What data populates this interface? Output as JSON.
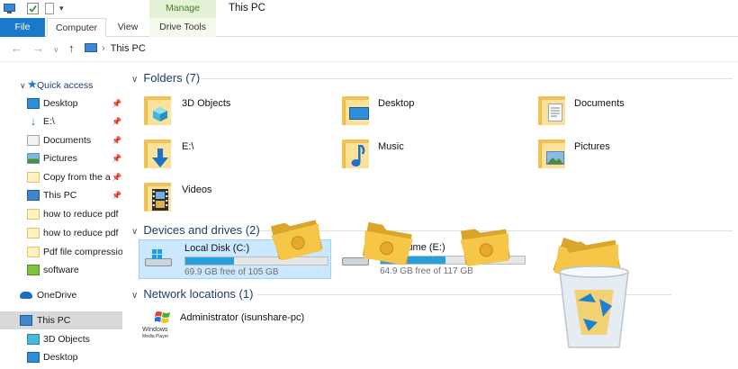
{
  "window": {
    "title": "This PC"
  },
  "ribbon": {
    "contextual_tab": "Manage",
    "tabs": [
      {
        "label": "File"
      },
      {
        "label": "Computer"
      },
      {
        "label": "View"
      },
      {
        "label": "Drive Tools"
      }
    ]
  },
  "address": {
    "path": "This PC"
  },
  "sidebar": {
    "quick_access": "Quick access",
    "items": [
      {
        "label": "Desktop",
        "icon": "desktop-icon",
        "pinned": true
      },
      {
        "label": "E:\\",
        "icon": "download-arrow-icon",
        "pinned": true
      },
      {
        "label": "Documents",
        "icon": "documents-icon",
        "pinned": true
      },
      {
        "label": "Pictures",
        "icon": "pictures-icon",
        "pinned": true
      },
      {
        "label": "Copy from the a",
        "icon": "folder-icon",
        "pinned": true
      },
      {
        "label": "This PC",
        "icon": "pc-icon",
        "pinned": true
      },
      {
        "label": "how to reduce pdf",
        "icon": "folder-icon",
        "pinned": false
      },
      {
        "label": "how to reduce pdf",
        "icon": "folder-icon",
        "pinned": false
      },
      {
        "label": "Pdf file compressio",
        "icon": "folder-icon",
        "pinned": false
      },
      {
        "label": "software",
        "icon": "software-icon",
        "pinned": false
      }
    ],
    "onedrive": "OneDrive",
    "this_pc": "This PC",
    "this_pc_children": [
      {
        "label": "3D Objects",
        "icon": "cube-icon"
      },
      {
        "label": "Desktop",
        "icon": "desktop-icon"
      }
    ]
  },
  "folders_section": {
    "title": "Folders (7)",
    "items": [
      {
        "label": "3D Objects",
        "overlay": "cube-icon"
      },
      {
        "label": "Desktop",
        "overlay": "desktop-icon"
      },
      {
        "label": "Documents",
        "overlay": "document-icon"
      },
      {
        "label": "E:\\",
        "overlay": "download-arrow-icon"
      },
      {
        "label": "Music",
        "overlay": "music-note-icon"
      },
      {
        "label": "Pictures",
        "overlay": "picture-icon"
      },
      {
        "label": "Videos",
        "overlay": "film-icon"
      }
    ]
  },
  "devices_section": {
    "title": "Devices and drives (2)",
    "drives": [
      {
        "name": "Local Disk (C:)",
        "free_text": "69.9 GB free of 105 GB",
        "used_fraction": 0.34,
        "selected": true
      },
      {
        "name": "lume (E:)",
        "free_text": "64.9 GB free of 117 GB",
        "used_fraction": 0.45,
        "selected": false
      }
    ]
  },
  "network_section": {
    "title": "Network locations (1)",
    "items": [
      {
        "label": "Administrator (isunshare-pc)",
        "brand_line1": "Windows",
        "brand_line2": "Media Player"
      }
    ]
  },
  "colors": {
    "accent": "#1979ca",
    "manage_tab_bg": "#e3f2d4",
    "selection_bg": "#cce8ff",
    "drive_fill": "#26a0da",
    "section_title": "#1e3b6e",
    "folder_yellow": "#f4cf62"
  },
  "decorations": {
    "flying_folders": 4,
    "recycle_bin": "recycle-bin-icon"
  }
}
